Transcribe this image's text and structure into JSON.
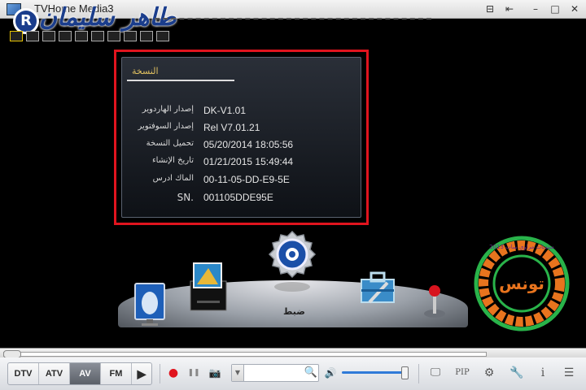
{
  "window": {
    "title": "TVHome Media3",
    "buttons": [
      "⊟",
      "⇤",
      "–",
      "□",
      "✕"
    ]
  },
  "overlay": {
    "watermark_text": "طاهر سليمان",
    "registered_mark": "R"
  },
  "info_panel": {
    "title": "النسخة",
    "rows": [
      {
        "label": "إصدار الهاردوير",
        "value": "DK-V1.01"
      },
      {
        "label": "إصدار السوفتوير",
        "value": "Rel V7.01.21"
      },
      {
        "label": "تحميل النسخة",
        "value": "05/20/2014 18:05:56"
      },
      {
        "label": "تاريخ الإنشاء",
        "value": "01/21/2015 15:49:44"
      },
      {
        "label": "الماك ادرس",
        "value": "00-11-05-DD-E9-5E"
      },
      {
        "label": "SN.",
        "value": "001105DDE95E"
      }
    ]
  },
  "menu": {
    "selected_caption": "ضبط"
  },
  "logo": {
    "center_text": "تونس",
    "ring_text": "منتديات مراوي سات 2013"
  },
  "controls": {
    "sources": [
      "DTV",
      "ATV",
      "AV",
      "FM"
    ],
    "active_source": "AV",
    "play_icon": "▶",
    "record_icon": "●",
    "pause_icon": "❚❚",
    "snapshot_icon": "📷",
    "volume_icon": "🔊",
    "volume_level_fraction": 0.95,
    "right_icons": [
      "🖵",
      "PIP",
      "⚙",
      "🔧",
      "i",
      "☰"
    ],
    "accent": "#2f7ad8",
    "record_color": "#e0141e"
  }
}
